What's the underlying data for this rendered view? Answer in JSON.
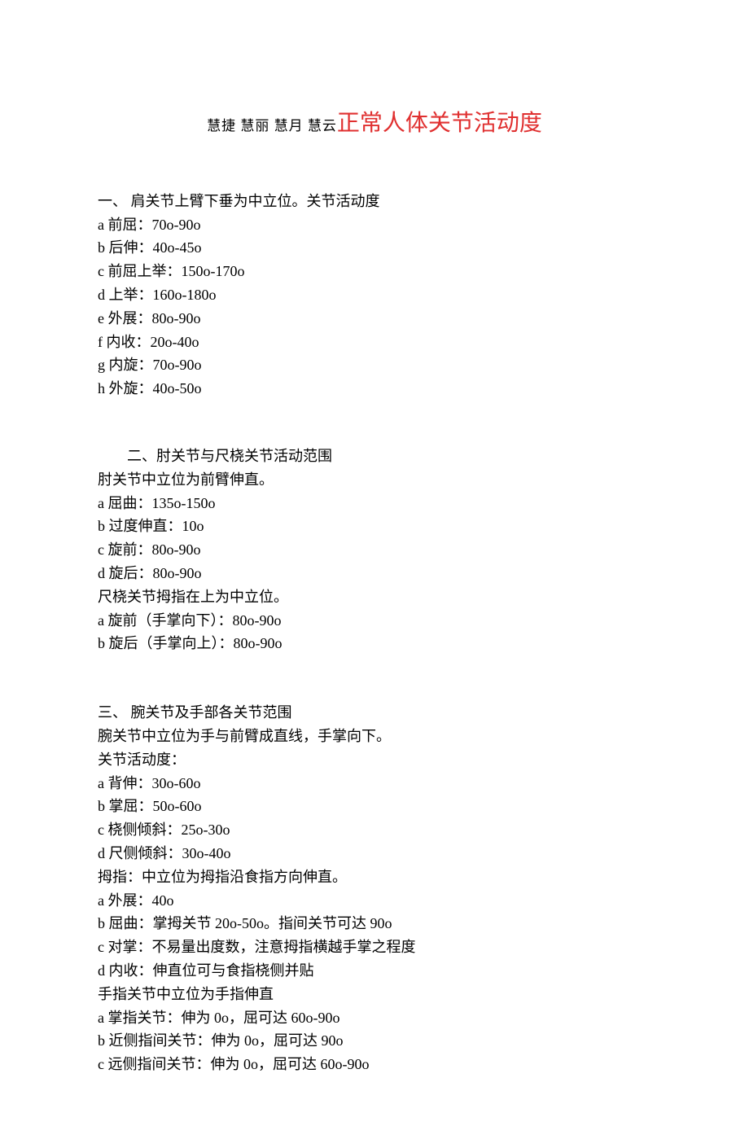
{
  "title": {
    "prefix": "慧捷 慧丽 慧月 慧云",
    "main": "正常人体关节活动度"
  },
  "section1": {
    "heading": "一、 肩关节上臂下垂为中立位。关节活动度",
    "items": [
      "a  前屈：70o-90o",
      "b  后伸：40o-45o",
      "c  前屈上举：150o-170o",
      "d  上举：160o-180o",
      "e  外展：80o-90o",
      "f  内收：20o-40o",
      "g  内旋：70o-90o",
      "h  外旋：40o-50o"
    ]
  },
  "section2": {
    "heading": "二、肘关节与尺桡关节活动范围",
    "line1": "肘关节中立位为前臂伸直。",
    "itemsA": [
      "a  屈曲：135o-150o",
      "b  过度伸直：10o",
      "c  旋前：80o-90o",
      "d  旋后：80o-90o"
    ],
    "line2": "尺桡关节拇指在上为中立位。",
    "itemsB": [
      "a  旋前（手掌向下）：80o-90o",
      "b  旋后（手掌向上）：80o-90o"
    ]
  },
  "section3": {
    "heading": "三、  腕关节及手部各关节范围",
    "line1": "腕关节中立位为手与前臂成直线，手掌向下。",
    "line2": "关节活动度：",
    "itemsA": [
      "a  背伸：30o-60o",
      "b  掌屈：50o-60o",
      "c  桡侧倾斜：25o-30o",
      "d  尺侧倾斜：30o-40o"
    ],
    "line3": "拇指：中立位为拇指沿食指方向伸直。",
    "itemsB": [
      "a  外展：40o",
      "b  屈曲：掌拇关节 20o-50o。指间关节可达 90o",
      "c  对掌：不易量出度数，注意拇指横越手掌之程度",
      "d  内收：伸直位可与食指桡侧并贴"
    ],
    "line4": "手指关节中立位为手指伸直",
    "itemsC": [
      "a  掌指关节：伸为 0o，屈可达 60o-90o",
      "b  近侧指间关节：伸为 0o，屈可达 90o",
      "c  远侧指间关节：伸为 0o，屈可达 60o-90o"
    ]
  }
}
